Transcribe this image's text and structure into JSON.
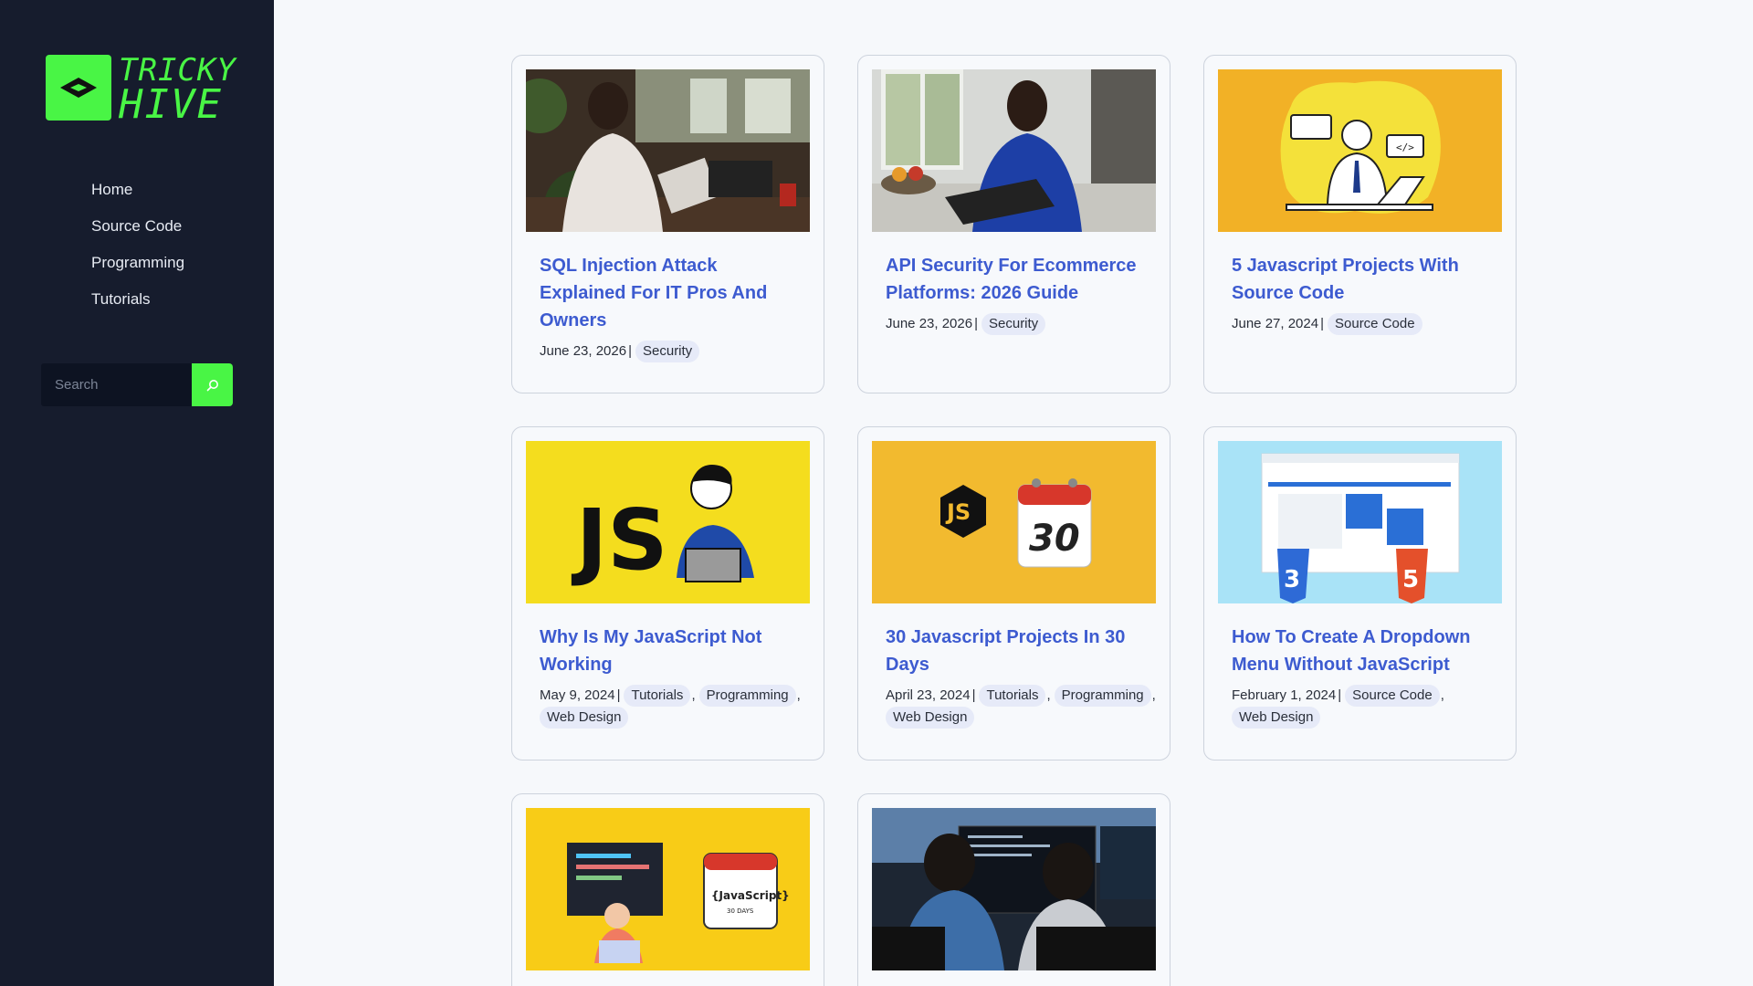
{
  "brand": {
    "line1": "TRICKY",
    "line2": "HIVE",
    "accent": "#49f545"
  },
  "nav": [
    "Home",
    "Source Code",
    "Programming",
    "Tutorials"
  ],
  "search": {
    "placeholder": "Search",
    "icon": "search-icon"
  },
  "posts": [
    {
      "title": "SQL Injection Attack Explained For IT Pros And Owners",
      "date": "June 23, 2026",
      "tags": [
        "Security"
      ],
      "image": "woman-reading-in-cafe"
    },
    {
      "title": "API Security For Ecommerce Platforms: 2026 Guide",
      "date": "June 23, 2026",
      "tags": [
        "Security"
      ],
      "image": "woman-on-laptop-kitchen"
    },
    {
      "title": "5 Javascript Projects With Source Code",
      "date": "June 27, 2024",
      "tags": [
        "Source Code"
      ],
      "image": "developer-illustration-yellow"
    },
    {
      "title": "Why Is My JavaScript Not Working",
      "date": "May 9, 2024",
      "tags": [
        "Tutorials",
        "Programming",
        "Web Design"
      ],
      "image": "js-confused-developer"
    },
    {
      "title": "30 Javascript Projects In 30 Days",
      "date": "April 23, 2024",
      "tags": [
        "Tutorials",
        "Programming",
        "Web Design"
      ],
      "image": "js-calendar-30"
    },
    {
      "title": "How To Create A Dropdown Menu Without JavaScript",
      "date": "February 1, 2024",
      "tags": [
        "Source Code",
        "Web Design"
      ],
      "image": "html-css-browser"
    },
    {
      "image": "javascript-30-days-illustration"
    },
    {
      "image": "two-developers-monitors"
    }
  ]
}
